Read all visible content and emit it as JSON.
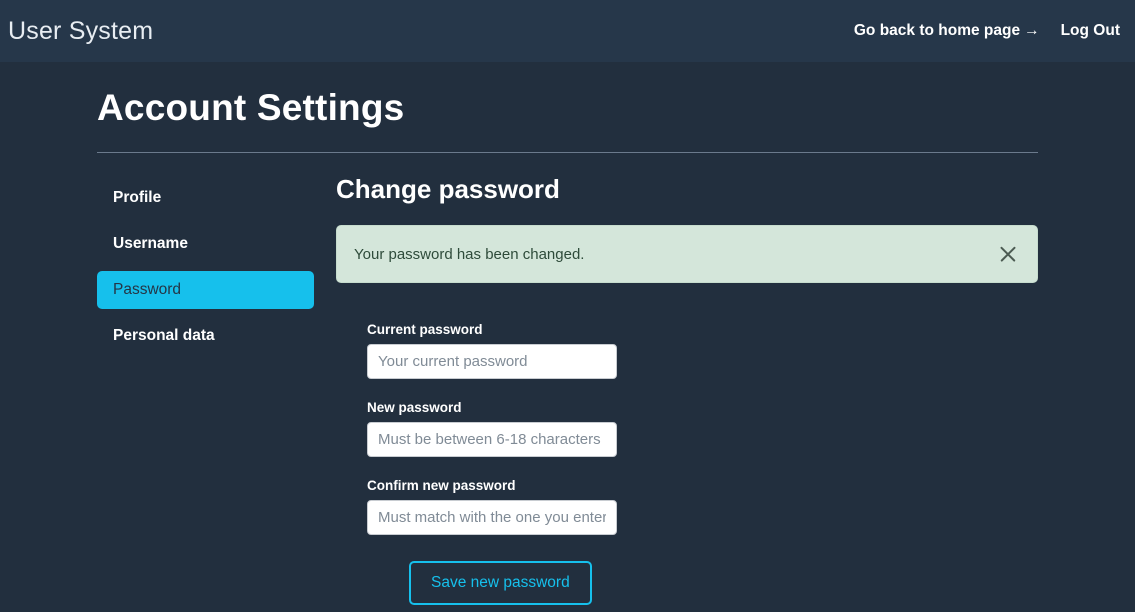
{
  "header": {
    "brand": "User System",
    "nav": [
      {
        "label": "Go back to home page",
        "arrow": "→",
        "name": "home-link"
      },
      {
        "label": "Log Out",
        "arrow": "",
        "name": "logout-link"
      }
    ]
  },
  "page": {
    "title": "Account Settings"
  },
  "sidebar": {
    "items": [
      {
        "label": "Profile",
        "active": false
      },
      {
        "label": "Username",
        "active": false
      },
      {
        "label": "Password",
        "active": true
      },
      {
        "label": "Personal data",
        "active": false
      }
    ]
  },
  "main": {
    "section_title": "Change password",
    "alert": {
      "message": "Your password has been changed.",
      "close_icon": "close-icon",
      "background": "#d4e6da",
      "text_color": "#2e4b3a"
    },
    "form": {
      "fields": [
        {
          "label": "Current password",
          "placeholder": "Your current password",
          "value": ""
        },
        {
          "label": "New password",
          "placeholder": "Must be between 6-18 characters",
          "value": ""
        },
        {
          "label": "Confirm new password",
          "placeholder": "Must match with the one you entered",
          "value": ""
        }
      ],
      "submit_label": "Save new password"
    }
  },
  "colors": {
    "background": "#222f3e",
    "header_background": "#26374a",
    "accent": "#16c0ec",
    "divider": "#6b7a8c"
  }
}
